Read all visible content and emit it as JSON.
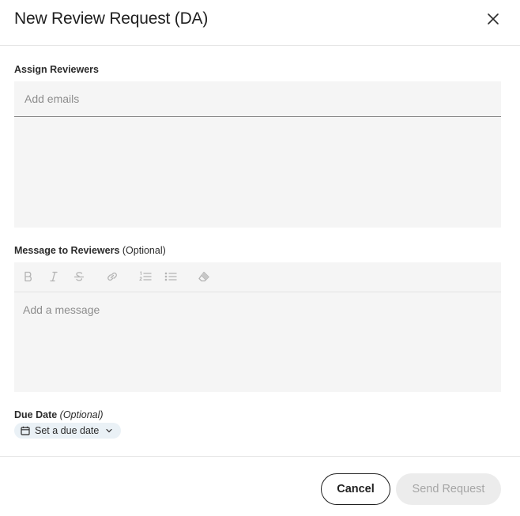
{
  "dialog": {
    "title": "New Review Request (DA)",
    "close_icon": "close-icon"
  },
  "reviewers": {
    "label": "Assign Reviewers",
    "placeholder": "Add emails"
  },
  "message": {
    "label": "Message to Reviewers",
    "optional": "(Optional)",
    "placeholder": "Add a message",
    "toolbar": [
      "bold-icon",
      "italic-icon",
      "strikethrough-icon",
      "link-icon",
      "ordered-list-icon",
      "bullet-list-icon",
      "clear-format-icon"
    ]
  },
  "due_date": {
    "label": "Due Date",
    "optional": "(Optional)",
    "button_label": "Set a due date",
    "icons": [
      "calendar-icon",
      "chevron-down-icon"
    ]
  },
  "footer": {
    "cancel_label": "Cancel",
    "send_label": "Send Request"
  },
  "colors": {
    "field_bg": "#f5f5f5",
    "due_chip_bg": "#eaf1f6",
    "send_disabled_bg": "#ececec"
  }
}
